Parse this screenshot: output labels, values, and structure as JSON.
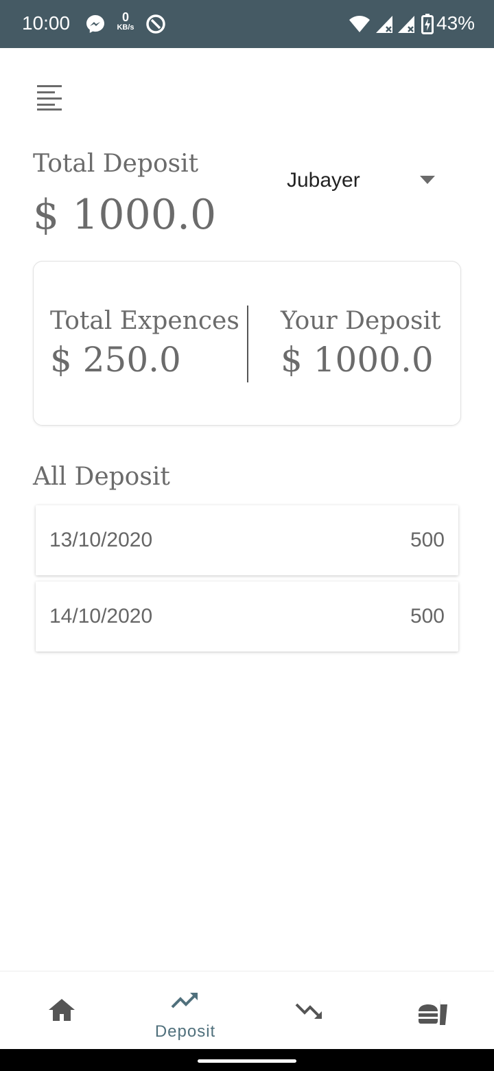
{
  "status_bar": {
    "time": "10:00",
    "net_speed_value": "0",
    "net_speed_unit": "KB/s",
    "battery_percent": "43%",
    "icons": [
      "messenger-icon",
      "at-sign-icon",
      "wifi-icon",
      "signal-icon",
      "signal-icon",
      "battery-charging-icon"
    ]
  },
  "header": {
    "menu_icon": "menu-icon",
    "total_deposit_label": "Total Deposit",
    "total_deposit_value": "$ 1000.0",
    "member_select": {
      "selected": "Jubayer"
    }
  },
  "summary": {
    "expenses_label": "Total Expences",
    "expenses_value": "$ 250.0",
    "your_deposit_label": "Your Deposit",
    "your_deposit_value": "$ 1000.0"
  },
  "deposits": {
    "title": "All Deposit",
    "rows": [
      {
        "date": "13/10/2020",
        "amount": "500"
      },
      {
        "date": "14/10/2020",
        "amount": "500"
      }
    ]
  },
  "bottom_nav": {
    "items": [
      {
        "icon": "home-icon",
        "label": ""
      },
      {
        "icon": "trending-up-icon",
        "label": "Deposit",
        "active": true
      },
      {
        "icon": "trending-down-icon",
        "label": ""
      },
      {
        "icon": "fastfood-icon",
        "label": ""
      }
    ]
  },
  "colors": {
    "status_bar": "#455a64",
    "active_nav": "#50707c",
    "text_muted": "#6b6b6b"
  }
}
